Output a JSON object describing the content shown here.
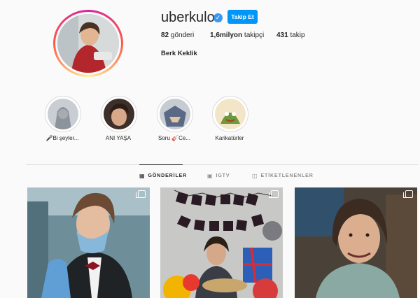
{
  "profile": {
    "username": "uberkuloz",
    "verified_icon": "verified-badge-icon",
    "follow_label": "Takip Et",
    "full_name": "Berk Keklik",
    "stats": {
      "posts_count": "82",
      "posts_label": "gönderi",
      "followers_count": "1,6milyon",
      "followers_label": "takipçi",
      "following_count": "431",
      "following_label": "takip"
    }
  },
  "highlights": [
    {
      "label": "🎤Bi şeyler..."
    },
    {
      "label": "ANI YAŞA"
    },
    {
      "label": "Soru 🎸Ce..."
    },
    {
      "label": "Karikatürler"
    }
  ],
  "tabs": [
    {
      "label": "GÖNDERİLER",
      "icon": "grid-icon",
      "active": true
    },
    {
      "label": "IGTV",
      "icon": "igtv-icon",
      "active": false
    },
    {
      "label": "ETİKETLENENLER",
      "icon": "tagged-icon",
      "active": false
    }
  ],
  "posts": [
    {
      "icon": "multiple-photos-icon"
    },
    {
      "icon": "multiple-photos-icon"
    },
    {
      "icon": "multiple-photos-icon"
    }
  ],
  "colors": {
    "accent": "#0095f6",
    "verified": "#3897f0",
    "background": "#fafafa",
    "divider": "#dbdbdb"
  }
}
